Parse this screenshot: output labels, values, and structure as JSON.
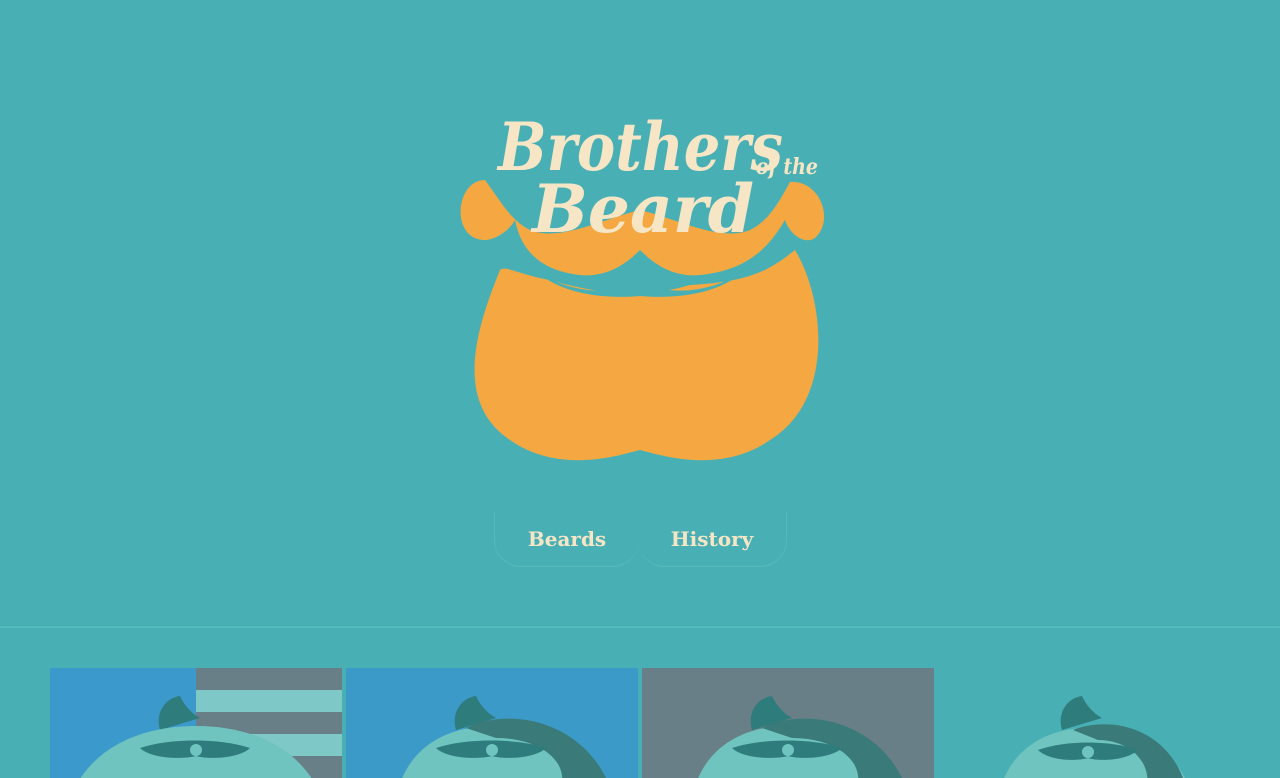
{
  "logo": {
    "title_line1": "Brothers",
    "title_line2": "Beard",
    "title_small": "of the",
    "icon": "beard-mustache-icon"
  },
  "nav": {
    "items": [
      {
        "label": "Beards"
      },
      {
        "label": "History"
      }
    ]
  },
  "gallery": {
    "tiles": [
      {
        "icon": "bearded-head-icon",
        "background": "#3b9acb"
      },
      {
        "icon": "bearded-head-icon",
        "background": "#3c9ac9"
      },
      {
        "icon": "bearded-head-icon",
        "background": "#697f87"
      },
      {
        "icon": "bearded-head-icon",
        "background": "#48b0b4"
      }
    ]
  },
  "colors": {
    "background": "#48b0b4",
    "beard_orange": "#f5a841",
    "cream_text": "#f7e6c6"
  }
}
